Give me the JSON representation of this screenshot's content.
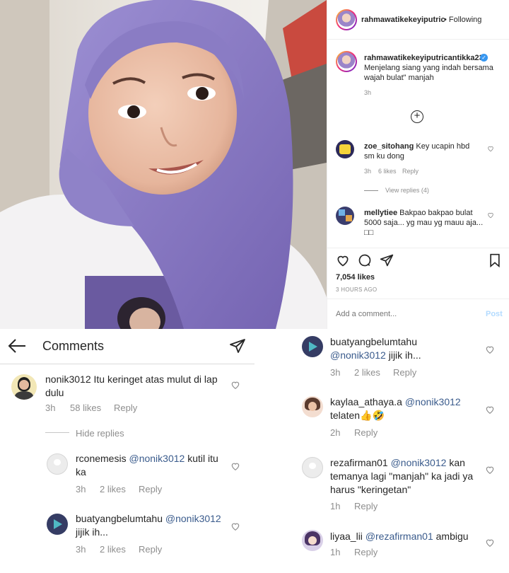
{
  "post": {
    "header_username": "rahmawatikekeyiputric",
    "header_following": "• Following",
    "caption_username": "rahmawatikekeyiputricantikka23",
    "caption_text": "Menjelang siang yang indah bersama wajah bulat\" manjah",
    "caption_time": "3h",
    "likes": "7,054 likes",
    "time_ago": "3 HOURS AGO",
    "add_comment_placeholder": "Add a comment...",
    "post_button": "Post"
  },
  "panel_comments": [
    {
      "username": "zoe_sitohang",
      "text": "Key ucapin hbd sm ku dong",
      "time": "3h",
      "likes": "6 likes",
      "reply": "Reply"
    },
    {
      "username": "mellytiee",
      "text": "Bakpao bakpao bulat 5000 saja... yg mau yg mauu aja... □□"
    }
  ],
  "view_replies": "View replies (4)",
  "comments_screen": {
    "title": "Comments",
    "main_comment": {
      "username": "nonik3012",
      "text": "Itu keringet atas mulut di lap dulu",
      "time": "3h",
      "likes": "58 likes",
      "reply": "Reply"
    },
    "hide_replies": "Hide replies",
    "replies": [
      {
        "username": "rconemesis",
        "mention": "@nonik3012",
        "text": "kutil itu ka",
        "time": "3h",
        "likes": "2 likes",
        "reply": "Reply"
      },
      {
        "username": "buatyangbelumtahu",
        "mention": "@nonik3012",
        "text": "jijik ih...",
        "time": "3h",
        "likes": "2 likes",
        "reply": "Reply"
      }
    ]
  },
  "right_comments": [
    {
      "username": "buatyangbelumtahu",
      "mention": "@nonik3012",
      "text": "jijik ih...",
      "time": "3h",
      "likes": "2 likes",
      "reply": "Reply"
    },
    {
      "username": "kaylaa_athaya.a",
      "mention": "@nonik3012",
      "text": "telaten👍🤣",
      "time": "2h",
      "reply": "Reply"
    },
    {
      "username": "rezafirman01",
      "mention": "@nonik3012",
      "text": "kan temanya lagi \"manjah\" ka jadi ya harus \"keringetan\"",
      "time": "1h",
      "reply": "Reply"
    },
    {
      "username": "liyaa_lii",
      "mention": "@rezafirman01",
      "text": "ambigu",
      "time": "1h",
      "reply": "Reply"
    }
  ],
  "colors": {
    "mention": "#3a5b8c",
    "muted": "#8e8e8e",
    "post_button": "#b3dbff",
    "hijab": "#8a7cc4"
  }
}
